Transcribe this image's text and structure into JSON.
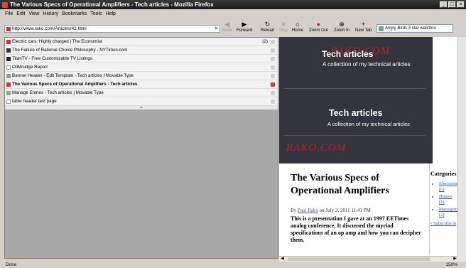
{
  "window": {
    "title": "The Various Specs of Operational Amplifiers - Tech articles - Mozilla Firefox"
  },
  "menu": [
    "File",
    "Edit",
    "View",
    "History",
    "Bookmarks",
    "Tools",
    "Help"
  ],
  "toolbar": {
    "url": "http://www.rako.com/Articles/42.html",
    "back": "Back",
    "forward": "Forward",
    "reload": "Reload",
    "stop": "Stop",
    "home": "Home",
    "zoom_out": "Zoom Out",
    "zoom_in": "Zoom In",
    "new_tab": "New Tab",
    "search_value": "Angry Birds 3 star walkthro"
  },
  "tabs": {
    "badge": "(2)",
    "items": [
      {
        "label": "Electric cars: Highly charged | The Economist"
      },
      {
        "label": "The Failure of Rational Choice Philosophy - NYTimes.com"
      },
      {
        "label": "TitanTV - Free Customizable TV Listings"
      },
      {
        "label": "OtiMrudge Report"
      },
      {
        "label": "Banner Header - Edit Template - Tech articles | Movable Type"
      },
      {
        "label": "The Various Specs of Operational Amplifiers - Tech articles"
      },
      {
        "label": "Manage Entries - Tech articles | Movable Type"
      },
      {
        "label": "table header test page"
      }
    ]
  },
  "page": {
    "logo": "RAKO.COM",
    "header_title": "Tech articles",
    "header_subtitle": "A collection of my technical articles",
    "header_title_2": "Tech articles",
    "header_subtitle_2": "A collection of my technical articles",
    "article_title": "The Various Specs of Operational Amplifiers",
    "byline_prefix": "By",
    "byline_author": "Paul Rako",
    "byline_suffix": "on July 2, 2011 11:41 PM",
    "article_body": "This is a presentation I gave at an 1997 EETimes analog conference. It discussed the myriad specifications of an op amp and how you can decipher them.",
    "categories_heading": "Categories",
    "categories": [
      {
        "name": "Electronics",
        "count": "(6)"
      },
      {
        "name": "Humor",
        "count": "(1)"
      },
      {
        "name": "Management",
        "count": "(2)"
      }
    ],
    "subscribe_link": "Subscribe to"
  },
  "status": {
    "text": "Done",
    "zoom": "150%"
  }
}
